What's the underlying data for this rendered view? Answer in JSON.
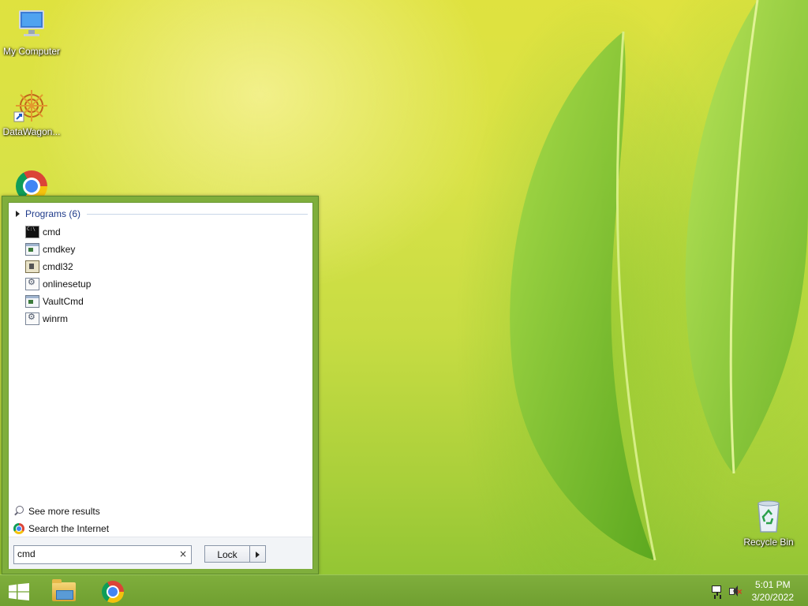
{
  "desktop": {
    "icons": [
      {
        "label": "My Computer",
        "icon": "computer-icon"
      },
      {
        "label": "DataWagon...",
        "icon": "datawagon-icon"
      },
      {
        "label": "",
        "icon": "chrome-icon"
      },
      {
        "label": "Recycle Bin",
        "icon": "recycle-bin-icon"
      }
    ]
  },
  "start_menu": {
    "programs_header": "Programs (6)",
    "programs": [
      {
        "label": "cmd",
        "icon": "cmd-icon"
      },
      {
        "label": "cmdkey",
        "icon": "window-app-icon"
      },
      {
        "label": "cmdl32",
        "icon": "installer-icon"
      },
      {
        "label": "onlinesetup",
        "icon": "gear-app-icon"
      },
      {
        "label": "VaultCmd",
        "icon": "window-app-icon"
      },
      {
        "label": "winrm",
        "icon": "gear-app-icon"
      }
    ],
    "see_more": "See more results",
    "search_internet": "Search the Internet",
    "search_value": "cmd",
    "clear_symbol": "×",
    "power_button_label": "Lock"
  },
  "taskbar": {
    "pinned": [
      {
        "name": "start-button",
        "icon": "windows-logo-icon"
      },
      {
        "name": "file-explorer",
        "icon": "folder-icon"
      },
      {
        "name": "chrome",
        "icon": "chrome-icon"
      }
    ],
    "clock": {
      "time": "5:01 PM",
      "date": "3/20/2022"
    }
  },
  "colors": {
    "accent": "#7fae3c",
    "link": "#1e3a8a"
  }
}
